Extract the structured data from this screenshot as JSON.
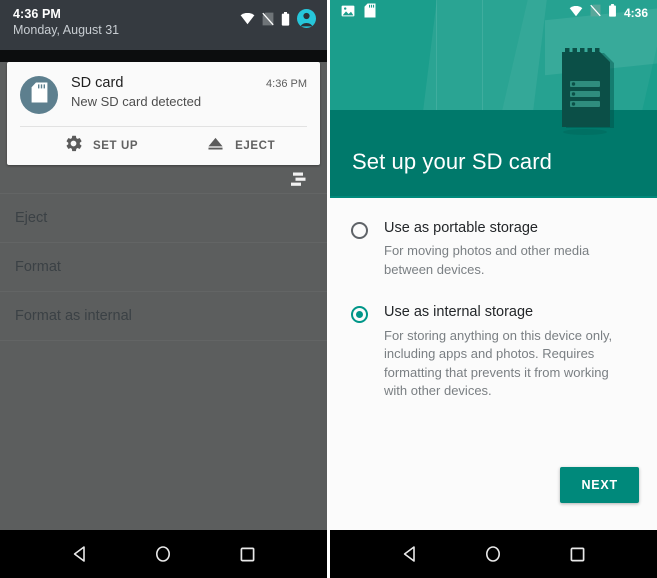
{
  "left_screen": {
    "status_bar": {
      "time": "4:36 PM",
      "date": "Monday, August 31",
      "icons": [
        "wifi-icon",
        "no-sim-icon",
        "battery-icon",
        "user-avatar-icon"
      ]
    },
    "notification": {
      "icon": "sd-card-icon",
      "title": "SD card",
      "subtitle": "New SD card detected",
      "time": "4:36 PM",
      "actions": [
        {
          "icon": "gear-icon",
          "label": "SET UP"
        },
        {
          "icon": "eject-icon",
          "label": "EJECT"
        }
      ]
    },
    "list": {
      "sort_icon": "sort-icon",
      "items": [
        {
          "label": "Eject"
        },
        {
          "label": "Format"
        },
        {
          "label": "Format as internal"
        }
      ]
    },
    "nav_bar": {
      "back": "back-icon",
      "home": "home-icon",
      "recents": "recents-icon"
    }
  },
  "right_screen": {
    "status_bar": {
      "left_icons": [
        "screenshot-icon",
        "sd-card-icon"
      ],
      "right_icons": [
        "wifi-icon",
        "no-sim-icon",
        "battery-icon"
      ],
      "time": "4:36"
    },
    "hero": {
      "title": "Set up your SD card",
      "art": "sd-card-illustration"
    },
    "options": [
      {
        "selected": false,
        "title": "Use as portable storage",
        "description": "For moving photos and other media between devices."
      },
      {
        "selected": true,
        "title": "Use as internal storage",
        "description": "For storing anything on this device only, including apps and photos. Requires formatting that prevents it from working with other devices."
      }
    ],
    "next_label": "NEXT",
    "nav_bar": {
      "back": "back-icon",
      "home": "home-icon",
      "recents": "recents-icon"
    }
  },
  "colors": {
    "teal_dark": "#00796b",
    "teal_light": "#1b9e8c",
    "accent": "#009688",
    "button": "#00897b",
    "status_bar_left": "#353a40",
    "scrim": "#5c5e5e",
    "avatar_cyan": "#26c6da"
  }
}
